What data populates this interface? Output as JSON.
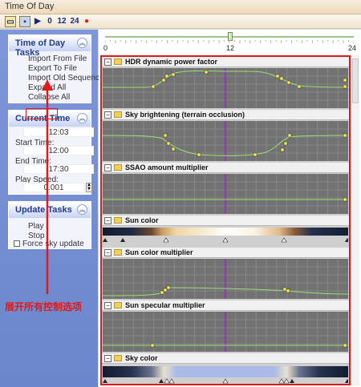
{
  "window": {
    "title": "Time Of Day"
  },
  "toolbar": {
    "btn_0": "0",
    "btn_12": "12",
    "btn_24": "24"
  },
  "slider": {
    "min_label": "0",
    "mid_label": "12",
    "max_label": "24",
    "value": 12
  },
  "tasks_panel": {
    "title": "Time of Day Tasks",
    "items": [
      "Import From File",
      "Export To File",
      "Import Old Sequence",
      "Expand All",
      "Collapse All"
    ]
  },
  "current_time_panel": {
    "title": "Current Time",
    "current_time": "12:03",
    "start_label": "Start Time:",
    "start_time": "12:00",
    "end_label": "End Time:",
    "end_time": "17:30",
    "speed_label": "Play Speed:",
    "speed": "0.001"
  },
  "update_panel": {
    "title": "Update Tasks",
    "play": "Play",
    "stop": "Stop",
    "force": "Force sky update"
  },
  "annotation": "展开所有控制选项",
  "tracks": [
    {
      "name": "HDR dynamic power factor"
    },
    {
      "name": "Sky brightening (terrain occlusion)"
    },
    {
      "name": "SSAO amount multiplier"
    },
    {
      "name": "Sun color"
    },
    {
      "name": "Sun color multiplier"
    },
    {
      "name": "Sun specular multiplier"
    },
    {
      "name": "Sky color"
    }
  ],
  "colors": {
    "highlight": "#e01a1a",
    "panel_bg": "#7f96d8",
    "curve": "#9be07a",
    "cursor": "#a020d0"
  }
}
